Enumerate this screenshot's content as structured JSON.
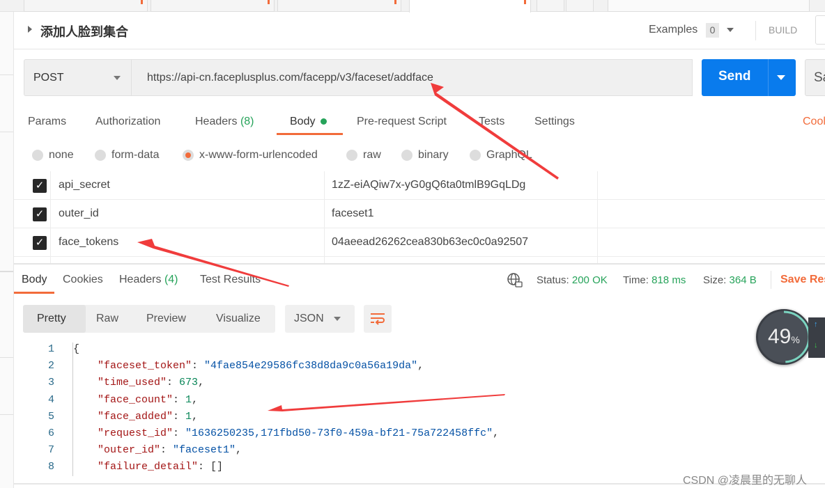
{
  "request": {
    "title": "添加人脸到集合",
    "examples_label": "Examples",
    "examples_count": "0",
    "build_label": "BUILD",
    "method": "POST",
    "url": "https://api-cn.faceplusplus.com/facepp/v3/faceset/addface",
    "send_label": "Send",
    "save_partial": "Sa",
    "tabs": [
      {
        "label": "Params"
      },
      {
        "label": "Authorization"
      },
      {
        "label": "Headers",
        "count": "(8)"
      },
      {
        "label": "Body",
        "active": true
      },
      {
        "label": "Pre-request Script"
      },
      {
        "label": "Tests"
      },
      {
        "label": "Settings"
      }
    ],
    "cookies_partial": "Cool",
    "body_types": [
      "none",
      "form-data",
      "x-www-form-urlencoded",
      "raw",
      "binary",
      "GraphQL"
    ],
    "body_type_selected": "x-www-form-urlencoded",
    "params": [
      {
        "key": "api_secret",
        "value": "1zZ-eiAQiw7x-yG0gQ6ta0tmlB9GqLDg",
        "checked": true
      },
      {
        "key": "outer_id",
        "value": "faceset1",
        "checked": true
      },
      {
        "key": "face_tokens",
        "value": "04aeead26262cea830b63ec0c0a92507",
        "checked": true
      }
    ]
  },
  "response": {
    "tabs": [
      {
        "label": "Body",
        "active": true
      },
      {
        "label": "Cookies"
      },
      {
        "label": "Headers",
        "count": "(4)"
      },
      {
        "label": "Test Results"
      }
    ],
    "status_label": "Status:",
    "status": "200 OK",
    "time_label": "Time:",
    "time": "818 ms",
    "size_label": "Size:",
    "size": "364 B",
    "save_partial": "Save Res",
    "views": [
      "Pretty",
      "Raw",
      "Preview",
      "Visualize"
    ],
    "view_selected": "Pretty",
    "format": "JSON",
    "code_lines": [
      {
        "n": "1",
        "text": "{"
      },
      {
        "n": "2",
        "key": "\"faceset_token\"",
        "value": "\"4fae854e29586fc38d8da9c0a56a19da\"",
        "type": "s",
        "trail": ","
      },
      {
        "n": "3",
        "key": "\"time_used\"",
        "value": "673",
        "type": "n",
        "trail": ","
      },
      {
        "n": "4",
        "key": "\"face_count\"",
        "value": "1",
        "type": "n",
        "trail": ","
      },
      {
        "n": "5",
        "key": "\"face_added\"",
        "value": "1",
        "type": "n",
        "trail": ","
      },
      {
        "n": "6",
        "key": "\"request_id\"",
        "value": "\"1636250235,171fbd50-73f0-459a-bf21-75a722458ffc\"",
        "type": "s",
        "trail": ","
      },
      {
        "n": "7",
        "key": "\"outer_id\"",
        "value": "\"faceset1\"",
        "type": "s",
        "trail": ","
      },
      {
        "n": "8",
        "key": "\"failure_detail\"",
        "value": "[]",
        "type": "p",
        "trail": ""
      }
    ]
  },
  "widget": {
    "percent": 49,
    "percent_text": "49",
    "unit": "%"
  },
  "watermark": "CSDN @凌晨里的无聊人",
  "colors": {
    "accent": "#f26b3a",
    "send": "#097bed",
    "success": "#26a35a",
    "annotation_arrow": "#f03c3c"
  }
}
